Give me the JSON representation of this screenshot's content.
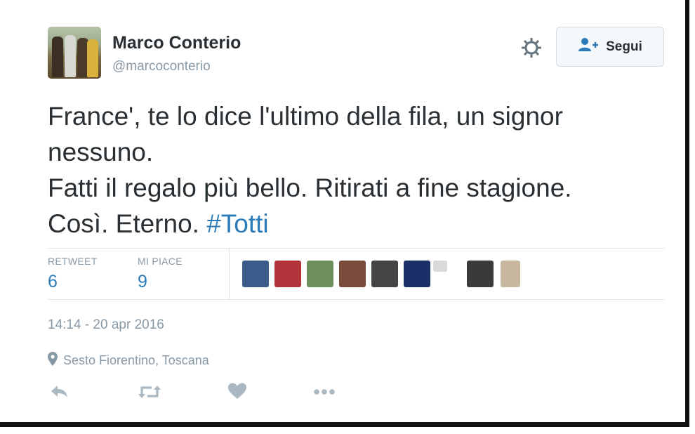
{
  "user": {
    "name": "Marco Conterio",
    "handle": "@marcoconterio"
  },
  "follow_button": {
    "label": "Segui"
  },
  "tweet": {
    "lines": [
      "France', te lo dice l'ultimo della fila, un signor",
      "nessuno.",
      "Fatti il regalo più bello. Ritirati a fine stagione."
    ],
    "last_line_text": "Così. Eterno. ",
    "hashtag": "#Totti"
  },
  "stats": {
    "retweet_label": "RETWEET",
    "retweet_count": "6",
    "likes_label": "MI PIACE",
    "likes_count": "9"
  },
  "likers": [
    {
      "name": "liker-avatar-1",
      "color": "#3b5b8a"
    },
    {
      "name": "liker-avatar-2",
      "color": "#b0343a"
    },
    {
      "name": "liker-avatar-3",
      "color": "#6f8f5a"
    },
    {
      "name": "liker-avatar-4",
      "color": "#7a4a3a"
    },
    {
      "name": "liker-avatar-5",
      "color": "#444444"
    },
    {
      "name": "liker-avatar-6",
      "color": "#1b2f6b"
    },
    {
      "name": "liker-avatar-7",
      "color": "#d9d9d9"
    },
    {
      "name": "liker-avatar-8",
      "color": "#3a3a3a"
    },
    {
      "name": "liker-avatar-9",
      "color": "#c9b8a0"
    }
  ],
  "timestamp": "14:14 - 20 apr 2016",
  "location": "Sesto Fiorentino, Toscana",
  "icons": {
    "gear": "gear-icon",
    "follow": "add-user-icon",
    "location": "location-pin-icon",
    "reply": "reply-icon",
    "retweet": "retweet-icon",
    "like": "heart-icon",
    "more": "more-icon"
  },
  "colors": {
    "link": "#2b7bb9",
    "text": "#292f33",
    "muted": "#8899a6",
    "action_icon": "#aab8c2"
  }
}
